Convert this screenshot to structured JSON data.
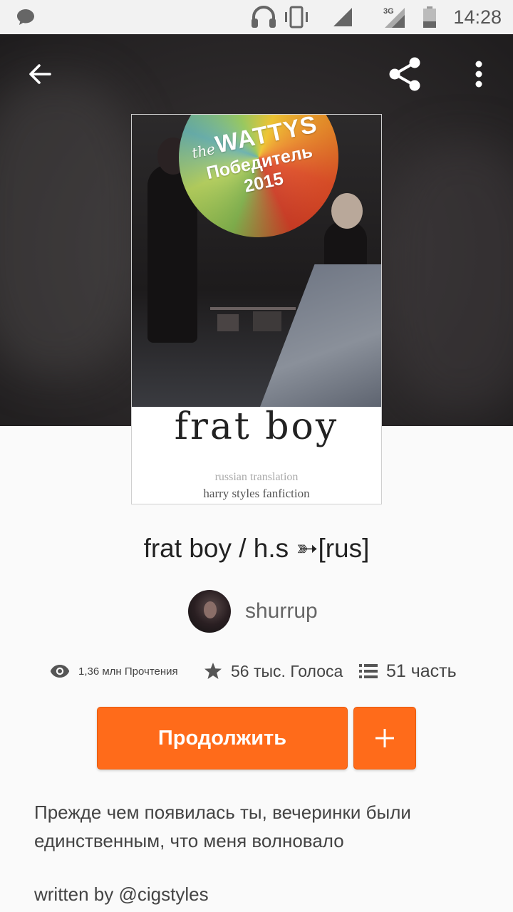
{
  "status_bar": {
    "time": "14:28",
    "icons": [
      "chat-icon",
      "headphones-icon",
      "vibrate-icon",
      "signal-icon",
      "3g-signal-icon",
      "battery-icon"
    ],
    "network_label": "3G"
  },
  "toolbar": {
    "back_icon": "arrow-left-icon",
    "share_icon": "share-icon",
    "more_icon": "more-vertical-icon"
  },
  "cover": {
    "badge_prefix": "the",
    "badge_name": "WATTYS",
    "badge_winner": "Победитель",
    "badge_year": "2015",
    "title": "frat boy",
    "subtitle_1": "russian translation",
    "subtitle_2": "harry styles fanfiction"
  },
  "story": {
    "title": "frat boy / h.s ➳[rus]",
    "author": "shurrup",
    "stats": {
      "reads": "1,36 млн Прочтения",
      "votes": "56 тыс. Голоса",
      "parts": "51 часть"
    },
    "continue_label": "Продолжить",
    "add_label": "+",
    "description": "Прежде чем появилась ты, вечеринки были единственным, что меня волновало",
    "written_by": "written by @cigstyles"
  },
  "colors": {
    "accent": "#ff6b1a",
    "status_bar_bg": "#f2f2f2",
    "hero_bg": "#2b2829",
    "page_bg": "#fafafa"
  }
}
